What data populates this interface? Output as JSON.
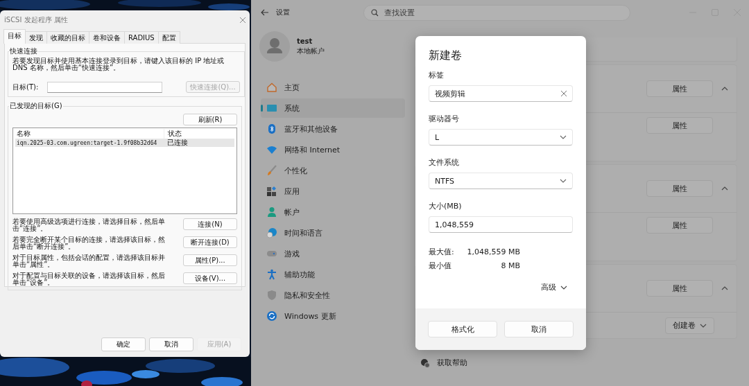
{
  "iscsi_dialog": {
    "title": "iSCSI 发起程序 属性",
    "tabs": [
      {
        "label": "目标",
        "selected": true
      },
      {
        "label": "发现",
        "selected": false
      },
      {
        "label": "收藏的目标",
        "selected": false
      },
      {
        "label": "卷和设备",
        "selected": false
      },
      {
        "label": "RADIUS",
        "selected": false
      },
      {
        "label": "配置",
        "selected": false
      }
    ],
    "quick_connect": {
      "heading": "快速连接",
      "description": "若要发现目标并使用基本连接登录到目标，请键入该目标的 IP 地址或 DNS 名称，然后单击“快速连接”。",
      "target_label": "目标(T):",
      "button": {
        "label": "快速连接(Q)...",
        "disabled": true
      }
    },
    "discovered": {
      "heading": "已发现的目标(G)",
      "refresh_button": "刷新(R)",
      "columns": [
        "名称",
        "状态"
      ],
      "rows": [
        {
          "name": "iqn.2025-03.com.ugreen:target-1.9f08b32d64",
          "status": "已连接",
          "selected": true
        }
      ],
      "actions": [
        {
          "description": "若要使用高级选项进行连接，请选择目标，然后单击“连接”。",
          "button": "连接(N)"
        },
        {
          "description": "若要完全断开某个目标的连接，请选择该目标，然后单击“断开连接”。",
          "button": "断开连接(D)"
        },
        {
          "description": "对于目标属性，包括会话的配置，请选择该目标并单击“属性”。",
          "button": "属性(P)..."
        },
        {
          "description": "对于配置与目标关联的设备，请选择该目标，然后单击“设备”。",
          "button": "设备(V)..."
        }
      ]
    },
    "buttons": [
      {
        "label": "确定",
        "disabled": false
      },
      {
        "label": "取消",
        "disabled": false
      },
      {
        "label": "应用(A)",
        "disabled": true
      }
    ]
  },
  "settings": {
    "title": "设置",
    "search": {
      "placeholder": "查找设置"
    },
    "user": {
      "name": "test",
      "account_type": "本地帐户"
    },
    "nav": [
      {
        "label": "主页",
        "selected": false
      },
      {
        "label": "系统",
        "selected": true
      },
      {
        "label": "蓝牙和其他设备",
        "selected": false
      },
      {
        "label": "网络和 Internet",
        "selected": false
      },
      {
        "label": "个性化",
        "selected": false
      },
      {
        "label": "应用",
        "selected": false
      },
      {
        "label": "帐户",
        "selected": false
      },
      {
        "label": "时间和语言",
        "selected": false
      },
      {
        "label": "游戏",
        "selected": false
      },
      {
        "label": "辅助功能",
        "selected": false
      },
      {
        "label": "隐私和安全性",
        "selected": false
      },
      {
        "label": "Windows 更新",
        "selected": false
      }
    ],
    "cards": [
      {
        "rows": [
          {
            "kind": "header",
            "button": "属性",
            "expanded": true
          },
          {
            "kind": "item",
            "button": "属性"
          }
        ]
      },
      {
        "rows": [
          {
            "kind": "header",
            "button": "属性",
            "expanded": true
          },
          {
            "kind": "item",
            "button": "属性"
          }
        ]
      },
      {
        "rows": [
          {
            "kind": "header",
            "button": "属性",
            "expanded": true
          },
          {
            "kind": "menu",
            "button": "创建卷"
          }
        ]
      }
    ],
    "help_link": "获取帮助"
  },
  "new_volume_dialog": {
    "title": "新建卷",
    "fields": [
      {
        "label": "标签",
        "kind": "text",
        "value": "视频剪辑"
      },
      {
        "label": "驱动器号",
        "kind": "select",
        "value": "L"
      },
      {
        "label": "文件系统",
        "kind": "select",
        "value": "NTFS"
      },
      {
        "label": "大小(MB)",
        "kind": "number",
        "value": "1,048,559"
      }
    ],
    "limits": [
      {
        "label": "最大值:",
        "value": "1,048,559 MB"
      },
      {
        "label": "最小值",
        "value": "8 MB"
      }
    ],
    "advanced": "高级",
    "buttons": [
      "格式化",
      "取消"
    ]
  }
}
